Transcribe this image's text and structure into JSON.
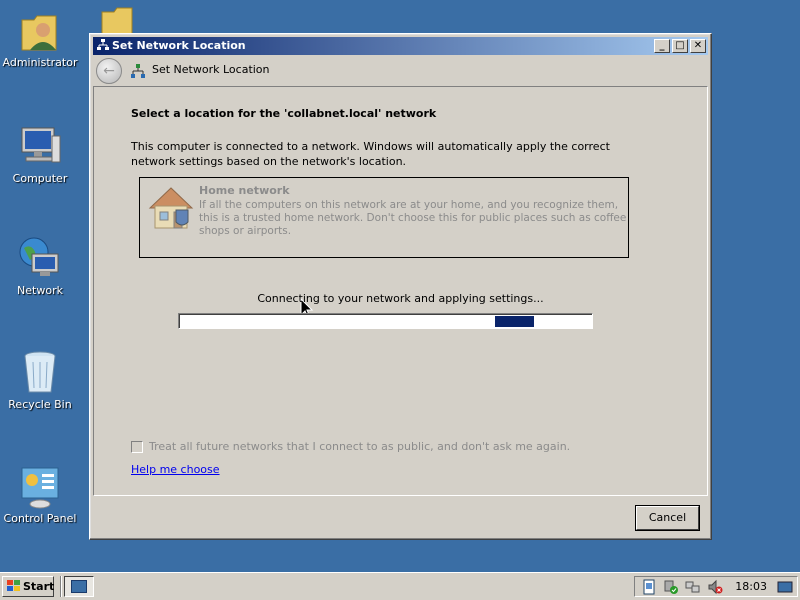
{
  "desktop": {
    "icons": [
      {
        "label": "Administrator"
      },
      {
        "label": ""
      },
      {
        "label": "Computer"
      },
      {
        "label": "Network"
      },
      {
        "label": "Recycle Bin"
      },
      {
        "label": "Control Panel"
      }
    ]
  },
  "window": {
    "title": "Set Network Location",
    "nav_title": "Set Network Location",
    "heading": "Select a location for the 'collabnet.local' network",
    "description": "This computer is connected to a network. Windows will automatically apply the correct network settings based on the network's location.",
    "home_option": {
      "title": "Home network",
      "description": "If all the computers on this network are at your home, and you recognize them, this is a trusted home network.  Don't choose this for public places such as coffee shops or airports."
    },
    "status_text": "Connecting to your network and applying settings...",
    "progress": {
      "indeterminate": true,
      "color": "#0a246a"
    },
    "checkbox_label": "Treat all future networks that I connect to as public, and don't ask me again.",
    "checkbox_checked": false,
    "help_link": "Help me choose",
    "cancel_label": "Cancel",
    "minimize_glyph": "_",
    "maximize_glyph": "□",
    "close_glyph": "✕",
    "back_glyph": "←"
  },
  "taskbar": {
    "start_label": "Start",
    "clock": "18:03"
  },
  "colors": {
    "desktop": "#3a6ea5",
    "titlebar_start": "#0a246a",
    "titlebar_end": "#a6caf0",
    "link": "#0000ee"
  }
}
